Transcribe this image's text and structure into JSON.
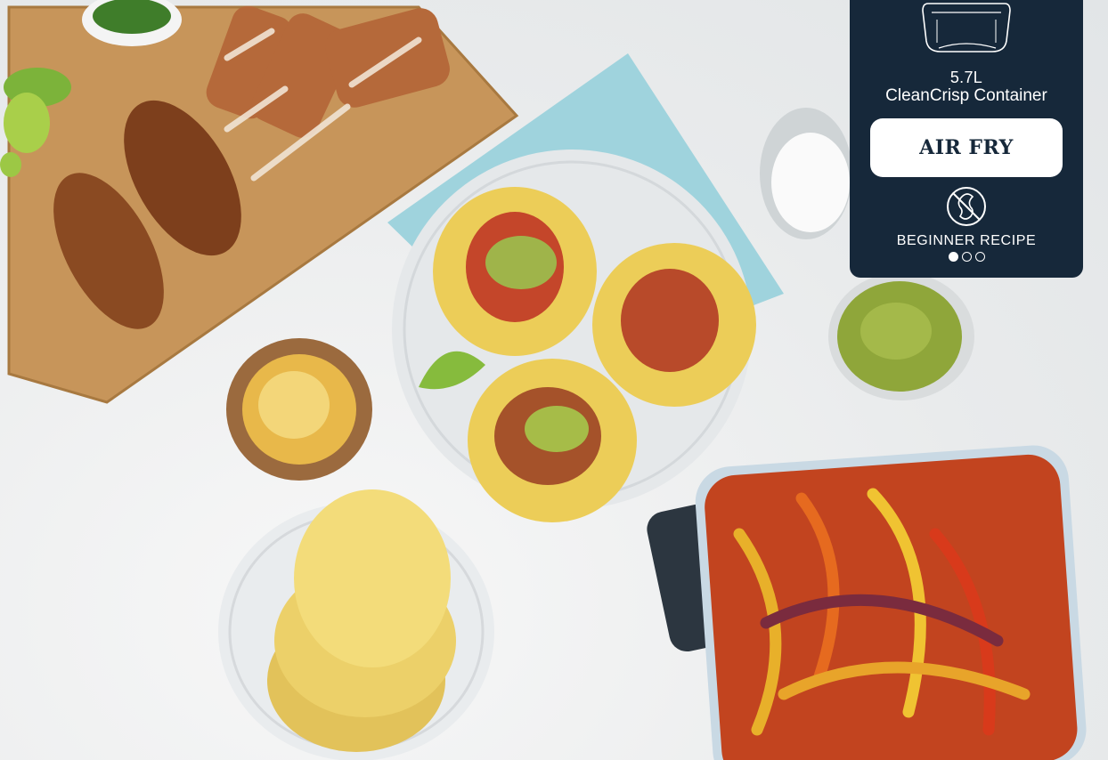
{
  "card": {
    "capacity": "5.7L",
    "container_name": "CleanCrisp Container",
    "mode_label": "AIR FRY",
    "level_label": "BEGINNER RECIPE",
    "carousel": {
      "total": 3,
      "active": 1
    },
    "bg_color": "#16283a"
  },
  "icons": {
    "container": "air-fryer-container-icon",
    "allergen": "no-nuts-icon"
  }
}
